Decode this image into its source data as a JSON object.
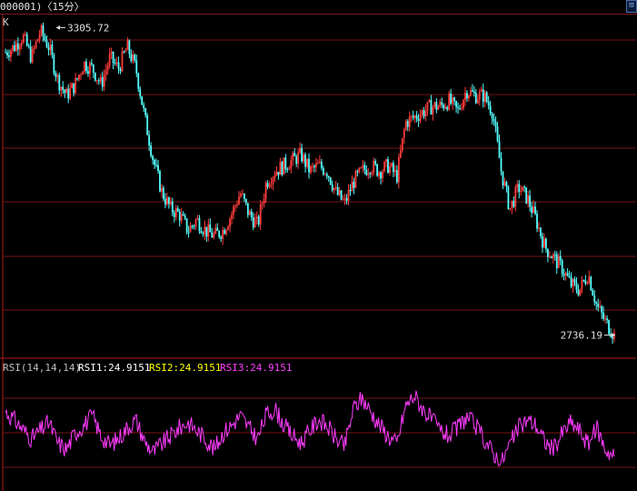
{
  "window": {
    "title": "000001)〈15分〉",
    "corner_icon": "window-toggle-icon"
  },
  "colors": {
    "background": "#000000",
    "grid": "#7a1414",
    "axis": "#b01c1c",
    "up_candle": "#ff3c3c",
    "down_candle": "#54ffff",
    "rsi1": "#ffffff",
    "rsi2": "#ffff00",
    "rsi3": "#ff3cff",
    "label": "#e0e0e0"
  },
  "chart_data": [
    {
      "type": "candlestick",
      "panel_label": "K",
      "ylim": [
        2700,
        3330
      ],
      "max_label": "3305.72",
      "min_label": "2736.19",
      "close_series": [
        3260,
        3270,
        3290,
        3250,
        3300,
        3270,
        3210,
        3180,
        3200,
        3240,
        3230,
        3200,
        3250,
        3230,
        3270,
        3230,
        3140,
        3060,
        3000,
        2970,
        2960,
        2930,
        2950,
        2930,
        2920,
        2930,
        2960,
        3000,
        2960,
        2940,
        3020,
        3040,
        3050,
        3060,
        3070,
        3040,
        3050,
        3040,
        3000,
        2980,
        3020,
        3040,
        3050,
        3040,
        3050,
        3030,
        3130,
        3140,
        3150,
        3160,
        3160,
        3170,
        3150,
        3190,
        3180,
        3180,
        3150,
        3040,
        2970,
        3010,
        2990,
        2950,
        2900,
        2880,
        2860,
        2830,
        2820,
        2850,
        2790,
        2760,
        2736
      ]
    },
    {
      "type": "line",
      "panel_label": "RSI(14,14,14)",
      "ylim": [
        0,
        100
      ],
      "series": [
        {
          "name": "RSI1",
          "value_label": "RSI1:24.9151",
          "values": []
        },
        {
          "name": "RSI2",
          "value_label": "RSI2:24.9151",
          "values": []
        },
        {
          "name": "RSI3",
          "value_label": "RSI3:24.9151",
          "values": [
            58,
            52,
            45,
            38,
            44,
            50,
            35,
            30,
            42,
            48,
            55,
            40,
            33,
            38,
            46,
            52,
            36,
            28,
            34,
            40,
            46,
            50,
            44,
            38,
            30,
            42,
            48,
            55,
            46,
            38,
            56,
            60,
            48,
            40,
            35,
            44,
            52,
            47,
            38,
            32,
            60,
            68,
            58,
            48,
            40,
            34,
            62,
            70,
            60,
            52,
            44,
            40,
            46,
            54,
            48,
            38,
            28,
            20,
            34,
            46,
            52,
            48,
            36,
            30,
            42,
            50,
            44,
            34,
            46,
            30,
            24.9
          ]
        }
      ]
    }
  ]
}
